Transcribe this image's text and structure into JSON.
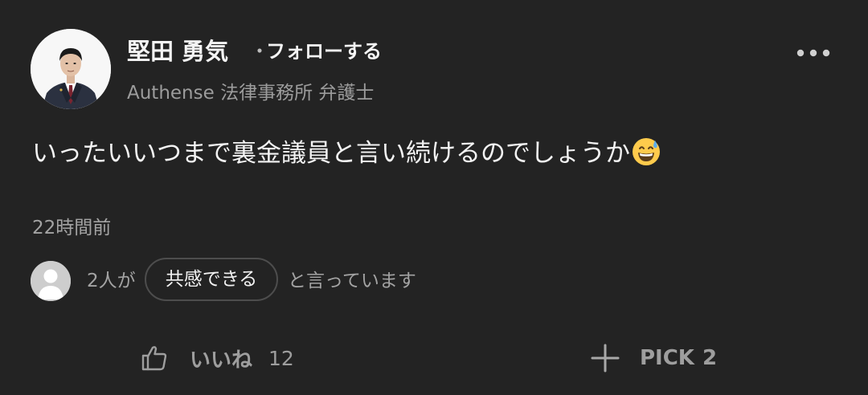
{
  "author": {
    "name": "堅田 勇気",
    "separator": "・",
    "follow_label": "フォローする",
    "affiliation": "Authense 法律事務所 弁護士"
  },
  "comment": {
    "text": "いったいいつまで裏金議員と言い続けるのでしょうか",
    "emoji": "grinning-sweat-emoji"
  },
  "timestamp": "22時間前",
  "empathy": {
    "prefix": "2人が",
    "chip_label": "共感できる",
    "suffix": "と言っています"
  },
  "actions": {
    "like_label": "いいね",
    "like_count": "12",
    "pick_label": "PICK",
    "pick_count": "2"
  },
  "icons": {
    "more": "more-dots-icon",
    "like": "thumbs-up-icon",
    "pick": "plus-icon",
    "reactor": "default-user-icon"
  },
  "colors": {
    "background": "#232323",
    "primary_text": "#f4f4f4",
    "secondary_text": "#a3a3a3",
    "chip_border": "#4d4d4d"
  }
}
